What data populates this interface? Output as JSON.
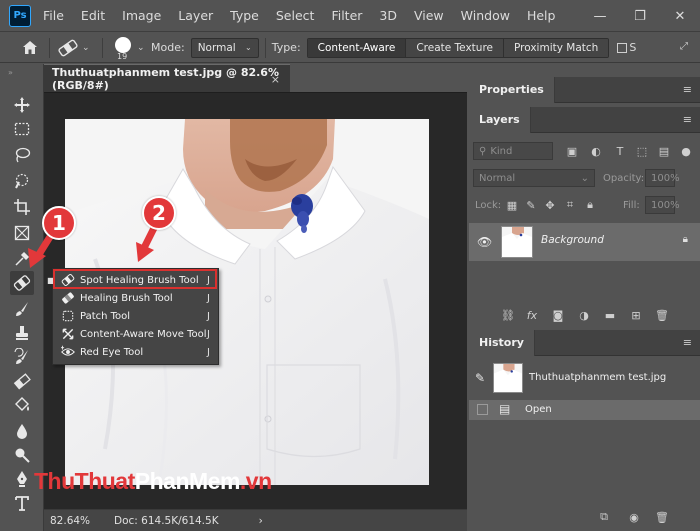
{
  "app": {
    "logo": "Ps",
    "menu": [
      "File",
      "Edit",
      "Image",
      "Layer",
      "Type",
      "Select",
      "Filter",
      "3D",
      "View",
      "Window",
      "Help"
    ],
    "window_controls": [
      "—",
      "❐",
      "✕"
    ]
  },
  "options_bar": {
    "brush_size": "19",
    "mode_label": "Mode:",
    "mode_value": "Normal",
    "type_label": "Type:",
    "type_options": [
      "Content-Aware",
      "Create Texture",
      "Proximity Match"
    ],
    "type_selected": "Content-Aware",
    "sample_letter": "S"
  },
  "document": {
    "tab_title": "Thuthuatphanmem test.jpg @ 82.6% (RGB/8#)",
    "close": "×",
    "zoom": "82.64%",
    "doc_info": "Doc: 614.5K/614.5K",
    "status_arrow": "›"
  },
  "flyout": {
    "items": [
      {
        "label": "Spot Healing Brush Tool",
        "key": "J",
        "icon": "spot-healing-brush-icon"
      },
      {
        "label": "Healing Brush Tool",
        "key": "J",
        "icon": "healing-brush-icon"
      },
      {
        "label": "Patch Tool",
        "key": "J",
        "icon": "patch-icon"
      },
      {
        "label": "Content-Aware Move Tool",
        "key": "J",
        "icon": "content-aware-move-icon"
      },
      {
        "label": "Red Eye Tool",
        "key": "J",
        "icon": "red-eye-icon"
      }
    ],
    "selected_index": 0,
    "bullet": "■"
  },
  "annotations": {
    "step1": "1",
    "step2": "2",
    "accent": "#e2383a"
  },
  "panels": {
    "properties": {
      "title": "Properties",
      "menu": "≡"
    },
    "layers": {
      "title": "Layers",
      "menu": "≡",
      "kind_placeholder": "Kind",
      "blend_mode": "Normal",
      "opacity_label": "Opacity:",
      "opacity_value": "100%",
      "lock_label": "Lock:",
      "fill_label": "Fill:",
      "fill_value": "100%",
      "layer_name": "Background"
    },
    "history": {
      "title": "History",
      "menu": "≡",
      "snapshot": "Thuthuatphanmem test.jpg",
      "state": "Open"
    }
  },
  "watermark": {
    "part1": "Thu",
    "part2": "Thuat",
    "part3": "Phan",
    "part4": "Mem",
    "part5": ".vn"
  },
  "colors": {
    "ui_bg": "#535353",
    "panel_header": "#424242",
    "canvas_bg": "#282828",
    "highlight": "#d9312f",
    "ink_blot": "#283c9a"
  }
}
